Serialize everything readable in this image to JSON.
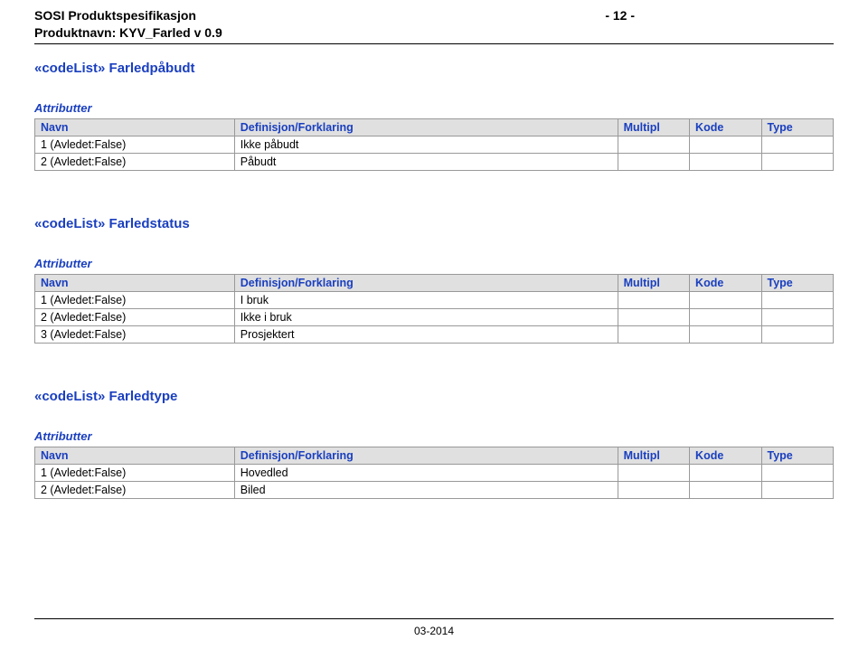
{
  "header": {
    "line1": "SOSI Produktspesifikasjon",
    "line2": "Produktnavn: KYV_Farled v 0.9",
    "page_marker": "- 12 -"
  },
  "table_headers": {
    "navn": "Navn",
    "definisjon": "Definisjon/Forklaring",
    "multipl": "Multipl",
    "kode": "Kode",
    "type": "Type"
  },
  "sections": [
    {
      "title": "«codeList» Farledpåbudt",
      "attrib_label": "Attributter",
      "rows": [
        {
          "navn": "1 (Avledet:False)",
          "def": "Ikke påbudt"
        },
        {
          "navn": "2 (Avledet:False)",
          "def": "Påbudt"
        }
      ]
    },
    {
      "title": "«codeList» Farledstatus",
      "attrib_label": "Attributter",
      "rows": [
        {
          "navn": "1 (Avledet:False)",
          "def": "I bruk"
        },
        {
          "navn": "2 (Avledet:False)",
          "def": "Ikke i bruk"
        },
        {
          "navn": "3 (Avledet:False)",
          "def": "Prosjektert"
        }
      ]
    },
    {
      "title": "«codeList» Farledtype",
      "attrib_label": "Attributter",
      "rows": [
        {
          "navn": "1 (Avledet:False)",
          "def": "Hovedled"
        },
        {
          "navn": "2 (Avledet:False)",
          "def": "Biled"
        }
      ]
    }
  ],
  "footer": {
    "date": "03-2014"
  }
}
